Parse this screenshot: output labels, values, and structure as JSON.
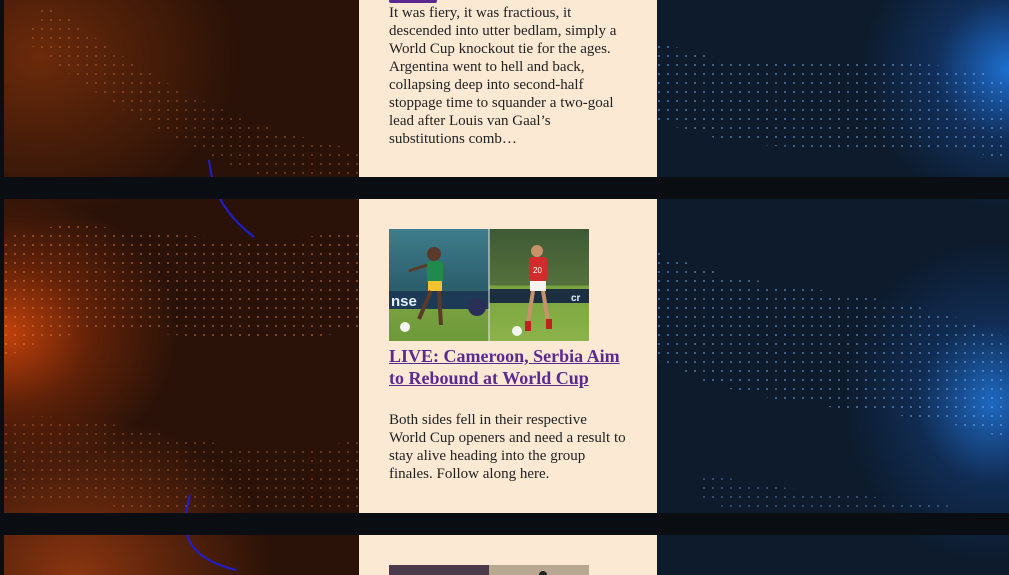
{
  "articles": [
    {
      "title": "",
      "excerpt": "It was fiery, it was fractious, it descended into utter bedlam, simply a World Cup knockout tie for the ages. Argentina went to hell and back, collapsing deep into second-half stoppage time to squander a two-goal lead after Louis van Gaal’s substitutions comb…"
    },
    {
      "title": "LIVE: Cameroon, Serbia Aim to Rebound at World Cup",
      "excerpt": "Both sides fell in their respective World Cup openers and need a result to stay alive heading into the group finales. Follow along here."
    }
  ],
  "colors": {
    "card_bg": "#fbe9d3",
    "link": "#5b2a91",
    "left_glow": "#c2410c",
    "right_glow": "#1e6fd0"
  }
}
